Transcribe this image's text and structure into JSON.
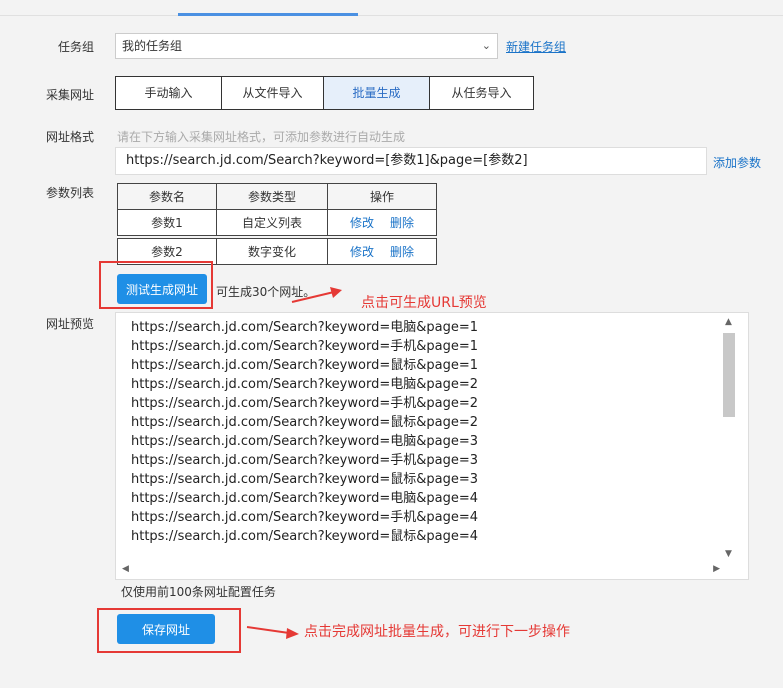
{
  "form": {
    "task_group_label": "任务组",
    "task_group_value": "我的任务组",
    "new_task_group_link": "新建任务组",
    "collect_url_label": "采集网址",
    "import_modes": [
      "手动输入",
      "从文件导入",
      "批量生成",
      "从任务导入"
    ],
    "active_mode": "批量生成",
    "url_format_label": "网址格式",
    "url_format_hint": "请在下方输入采集网址格式，可添加参数进行自动生成",
    "url_format_value": "https://search.jd.com/Search?keyword=[参数1]&page=[参数2]",
    "add_param_link": "添加参数",
    "param_list_label": "参数列表",
    "param_table": {
      "headers": [
        "参数名",
        "参数类型",
        "操作"
      ],
      "rows": [
        {
          "name": "参数1",
          "type": "自定义列表",
          "edit": "修改",
          "delete": "删除"
        },
        {
          "name": "参数2",
          "type": "数字变化",
          "edit": "修改",
          "delete": "删除"
        }
      ]
    },
    "test_button_label": "测试生成网址",
    "generate_count_text": "可生成30个网址。",
    "url_preview_label": "网址预览",
    "preview_urls": [
      "https://search.jd.com/Search?keyword=电脑&page=1",
      "https://search.jd.com/Search?keyword=手机&page=1",
      "https://search.jd.com/Search?keyword=鼠标&page=1",
      "https://search.jd.com/Search?keyword=电脑&page=2",
      "https://search.jd.com/Search?keyword=手机&page=2",
      "https://search.jd.com/Search?keyword=鼠标&page=2",
      "https://search.jd.com/Search?keyword=电脑&page=3",
      "https://search.jd.com/Search?keyword=手机&page=3",
      "https://search.jd.com/Search?keyword=鼠标&page=3",
      "https://search.jd.com/Search?keyword=电脑&page=4",
      "https://search.jd.com/Search?keyword=手机&page=4",
      "https://search.jd.com/Search?keyword=鼠标&page=4"
    ],
    "limit_note": "仅使用前100条网址配置任务",
    "save_button_label": "保存网址"
  },
  "annotations": {
    "test_hint": "点击可生成URL预览",
    "save_hint": "点击完成网址批量生成，可进行下一步操作"
  },
  "colors": {
    "accent": "#1f8fe6",
    "annotation_red": "#e53935",
    "link": "#1a73c8"
  }
}
